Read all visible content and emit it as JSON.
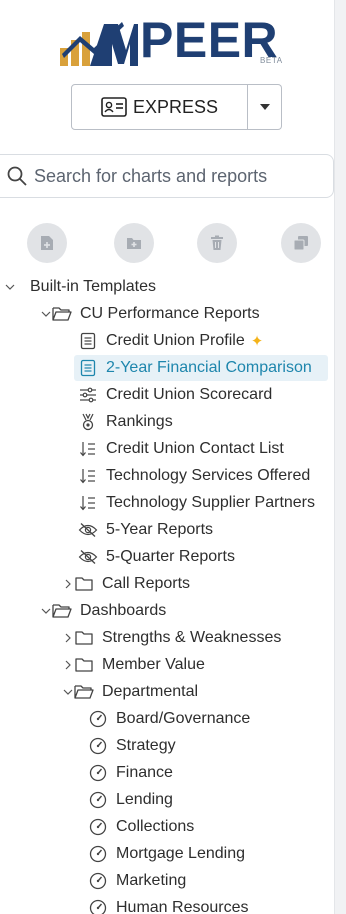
{
  "logo": {
    "wordmark": "PEER",
    "badge": "BETA"
  },
  "express": {
    "label": "EXPRESS"
  },
  "search": {
    "placeholder": "Search for charts and reports"
  },
  "colors": {
    "brand": "#1f3f73",
    "selected_bg": "#e7f1f7",
    "selected_text": "#1e86ad",
    "sparkle": "#f4b319"
  },
  "tree": {
    "built_in_templates": "Built-in Templates",
    "cu_performance_reports": "CU Performance Reports",
    "credit_union_profile": "Credit Union Profile",
    "two_year_financial_comparison": "2-Year Financial Comparison",
    "credit_union_scorecard": "Credit Union Scorecard",
    "rankings": "Rankings",
    "credit_union_contact_list": "Credit Union Contact List",
    "technology_services_offered": "Technology Services Offered",
    "technology_supplier_partners": "Technology Supplier Partners",
    "five_year_reports": "5-Year Reports",
    "five_quarter_reports": "5-Quarter Reports",
    "call_reports": "Call Reports",
    "dashboards": "Dashboards",
    "strengths_weaknesses": "Strengths & Weaknesses",
    "member_value": "Member Value",
    "departmental": "Departmental",
    "board_governance": "Board/Governance",
    "strategy": "Strategy",
    "finance": "Finance",
    "lending": "Lending",
    "collections": "Collections",
    "mortgage_lending": "Mortgage Lending",
    "marketing": "Marketing",
    "human_resources": "Human Resources"
  }
}
